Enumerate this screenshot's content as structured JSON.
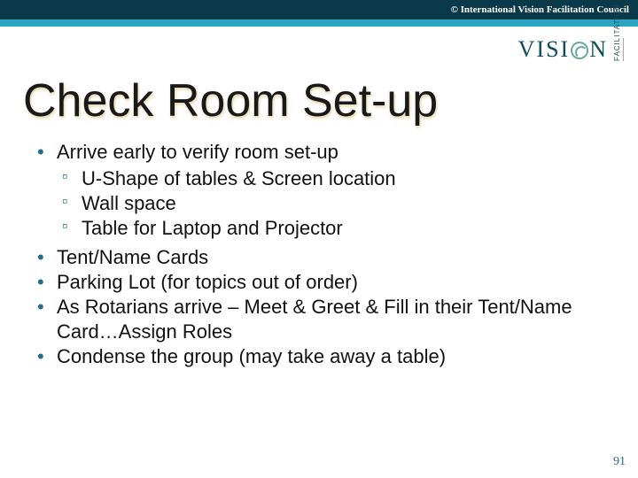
{
  "header": {
    "copyright": "© International Vision Facilitation Council"
  },
  "logo": {
    "pre": "VISI",
    "post": "N",
    "sub": "FACILITATION"
  },
  "title": "Check Room Set-up",
  "bullets": {
    "b1": "Arrive early to verify room set-up",
    "b1_sub": {
      "s1": "U-Shape of tables & Screen location",
      "s2": "Wall space",
      "s3": "Table for Laptop and Projector"
    },
    "b2": "Tent/Name Cards",
    "b3": "Parking Lot (for topics out of order)",
    "b4": "As Rotarians arrive – Meet & Greet & Fill in their Tent/Name Card…Assign Roles",
    "b5": "Condense the group (may take away a table)"
  },
  "page_number": "91"
}
